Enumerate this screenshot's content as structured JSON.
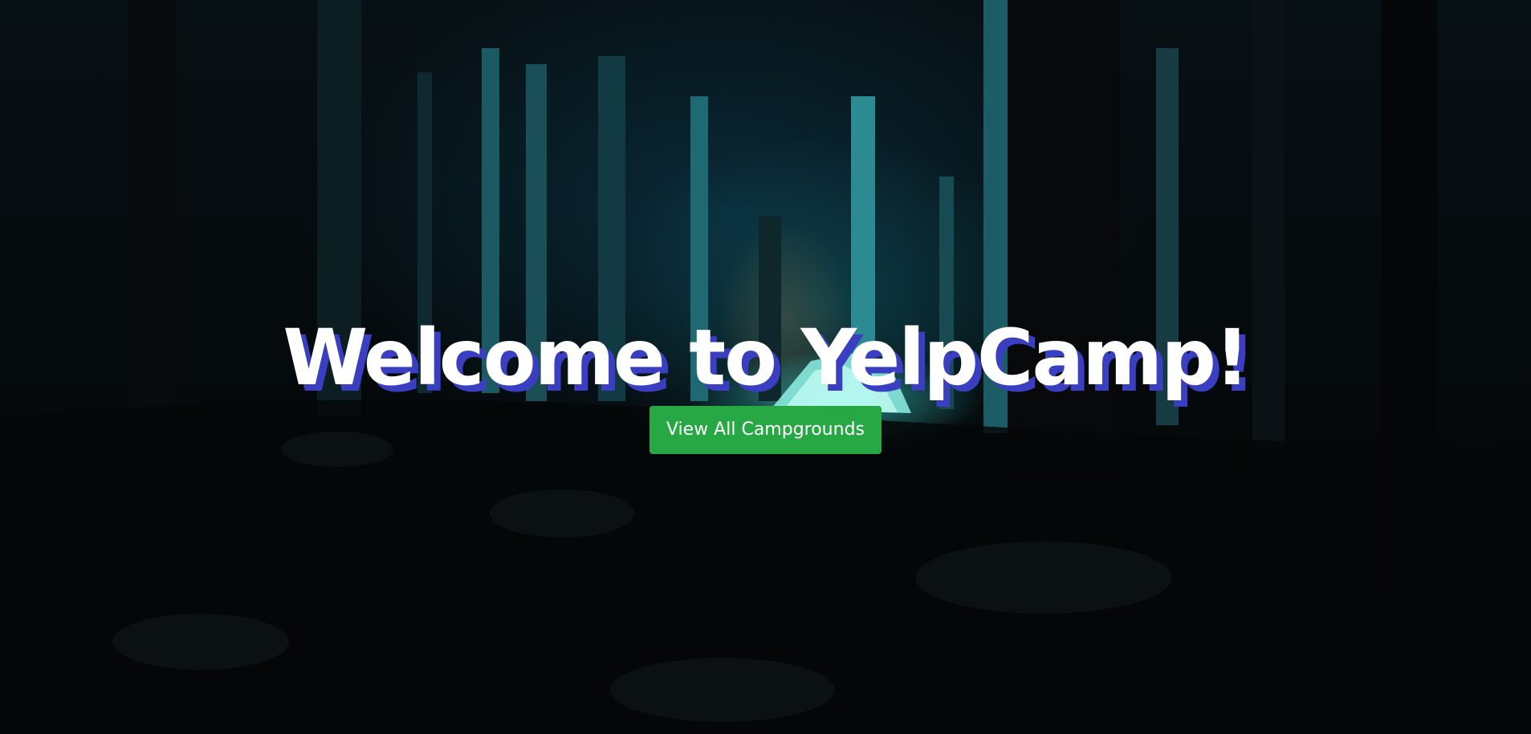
{
  "hero": {
    "title": "Welcome to YelpCamp!",
    "button_label": "View All Campgrounds"
  },
  "colors": {
    "title_text": "#ffffff",
    "title_shadow": "#3a3fc2",
    "button_background": "#28a745",
    "button_text": "#ffffff"
  },
  "background": {
    "description_icon": "night-forest-camp-background"
  }
}
